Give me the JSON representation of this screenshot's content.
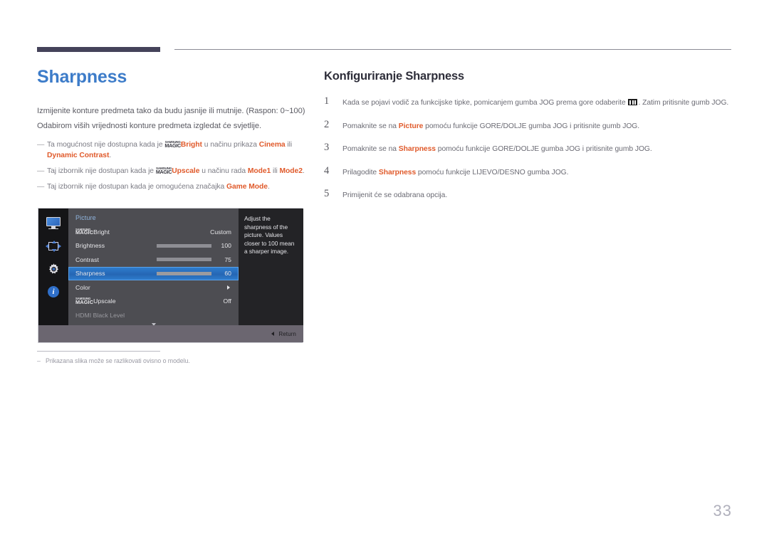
{
  "document": {
    "page_number": "33"
  },
  "left": {
    "title": "Sharpness",
    "body": [
      "Izmijenite konture predmeta tako da budu jasnije ili mutnije. (Raspon: 0~100)",
      "Odabirom viših vrijednosti konture predmeta izgledat će svjetlije."
    ],
    "notes": [
      {
        "pre": "Ta mogućnost nije dostupna kada je ",
        "logo_top": "SAMSUNG",
        "logo_bottom": "MAGIC",
        "kw1": "Bright",
        "mid": " u načinu prikaza ",
        "kw2": "Cinema",
        "mid2": " ili ",
        "kw3": "Dynamic Contrast",
        "post": "."
      },
      {
        "pre": "Taj izbornik nije dostupan kada je ",
        "logo_top": "SAMSUNG",
        "logo_bottom": "MAGIC",
        "kw1": "Upscale",
        "mid": " u načinu rada ",
        "kw2": "Mode1",
        "mid2": " ili ",
        "kw3": "Mode2",
        "post": "."
      },
      {
        "pre": "Taj izbornik nije dostupan kada je omogućena značajka ",
        "kw1": "Game Mode",
        "post": "."
      }
    ],
    "footnote": {
      "dash": "–",
      "text": "Prikazana slika može se razlikovati ovisno o modelu."
    }
  },
  "osd": {
    "menu_title": "Picture",
    "sidebar_icons": [
      {
        "name": "monitor-icon"
      },
      {
        "name": "screen-adjust-icon"
      },
      {
        "name": "gear-icon"
      },
      {
        "name": "info-icon"
      }
    ],
    "rows": [
      {
        "label_logo_top": "SAMSUNG",
        "label_logo_bottom": "MAGIC",
        "label": "Bright",
        "value": "Custom",
        "type": "value",
        "selected": false,
        "dim": false
      },
      {
        "label": "Brightness",
        "value": "100",
        "type": "slider",
        "fill_pct": 100,
        "selected": false,
        "dim": false
      },
      {
        "label": "Contrast",
        "value": "75",
        "type": "slider",
        "fill_pct": 75,
        "selected": false,
        "dim": false
      },
      {
        "label": "Sharpness",
        "value": "60",
        "type": "slider",
        "fill_pct": 60,
        "selected": true,
        "dim": false
      },
      {
        "label": "Color",
        "value": "",
        "type": "submenu",
        "selected": false,
        "dim": false
      },
      {
        "label_logo_top": "SAMSUNG",
        "label_logo_bottom": "MAGIC",
        "label": "Upscale",
        "value": "Off",
        "type": "value",
        "selected": false,
        "dim": false
      },
      {
        "label": "HDMI Black Level",
        "value": "",
        "type": "plain",
        "selected": false,
        "dim": true
      }
    ],
    "help_text": "Adjust the sharpness of the picture. Values closer to 100 mean a sharper image.",
    "return_label": "Return"
  },
  "right": {
    "title": "Konfiguriranje Sharpness",
    "steps": [
      {
        "num": "1",
        "pre": "Kada se pojavi vodič za funkcijske tipke, pomicanjem gumba JOG prema gore odaberite ",
        "icon": "menu-bars-icon",
        "post": ". Zatim pritisnite gumb JOG."
      },
      {
        "num": "2",
        "pre": "Pomaknite se na ",
        "kw": "Picture",
        "post": " pomoću funkcije GORE/DOLJE gumba JOG i pritisnite gumb JOG."
      },
      {
        "num": "3",
        "pre": "Pomaknite se na ",
        "kw": "Sharpness",
        "post": " pomoću funkcije GORE/DOLJE gumba JOG i pritisnite gumb JOG."
      },
      {
        "num": "4",
        "pre": "Prilagodite ",
        "kw": "Sharpness",
        "post": " pomoću funkcije LIJEVO/DESNO gumba JOG."
      },
      {
        "num": "5",
        "pre": "Primijenit će se odabrana opcija.",
        "kw": "",
        "post": ""
      }
    ]
  },
  "colors": {
    "title_blue": "#3d7cc9",
    "keyword_orange": "#e05a2b",
    "header_bar": "#45435a",
    "osd_selected": "#2566b4"
  }
}
